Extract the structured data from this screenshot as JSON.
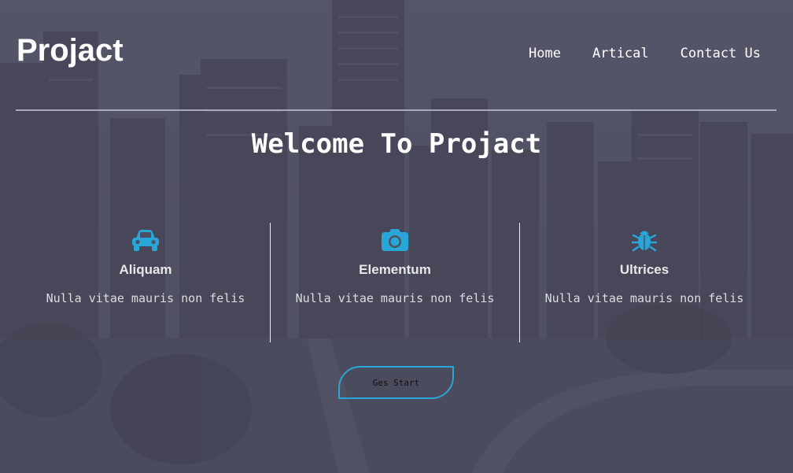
{
  "brand": {
    "logo": "Projact"
  },
  "nav": {
    "items": [
      "Home",
      "Artical",
      "Contact Us"
    ]
  },
  "hero": {
    "title": "Welcome To Projact"
  },
  "features": [
    {
      "icon": "car-icon",
      "title": "Aliquam",
      "text": "Nulla vitae mauris non felis"
    },
    {
      "icon": "camera-icon",
      "title": "Elementum",
      "text": "Nulla vitae mauris non felis"
    },
    {
      "icon": "bug-icon",
      "title": "Ultrices",
      "text": "Nulla vitae mauris non felis"
    }
  ],
  "cta": {
    "label": "Ges Start"
  },
  "colors": {
    "accent": "#29a6d8",
    "overlay": "#505064",
    "text": "#ffffff"
  }
}
